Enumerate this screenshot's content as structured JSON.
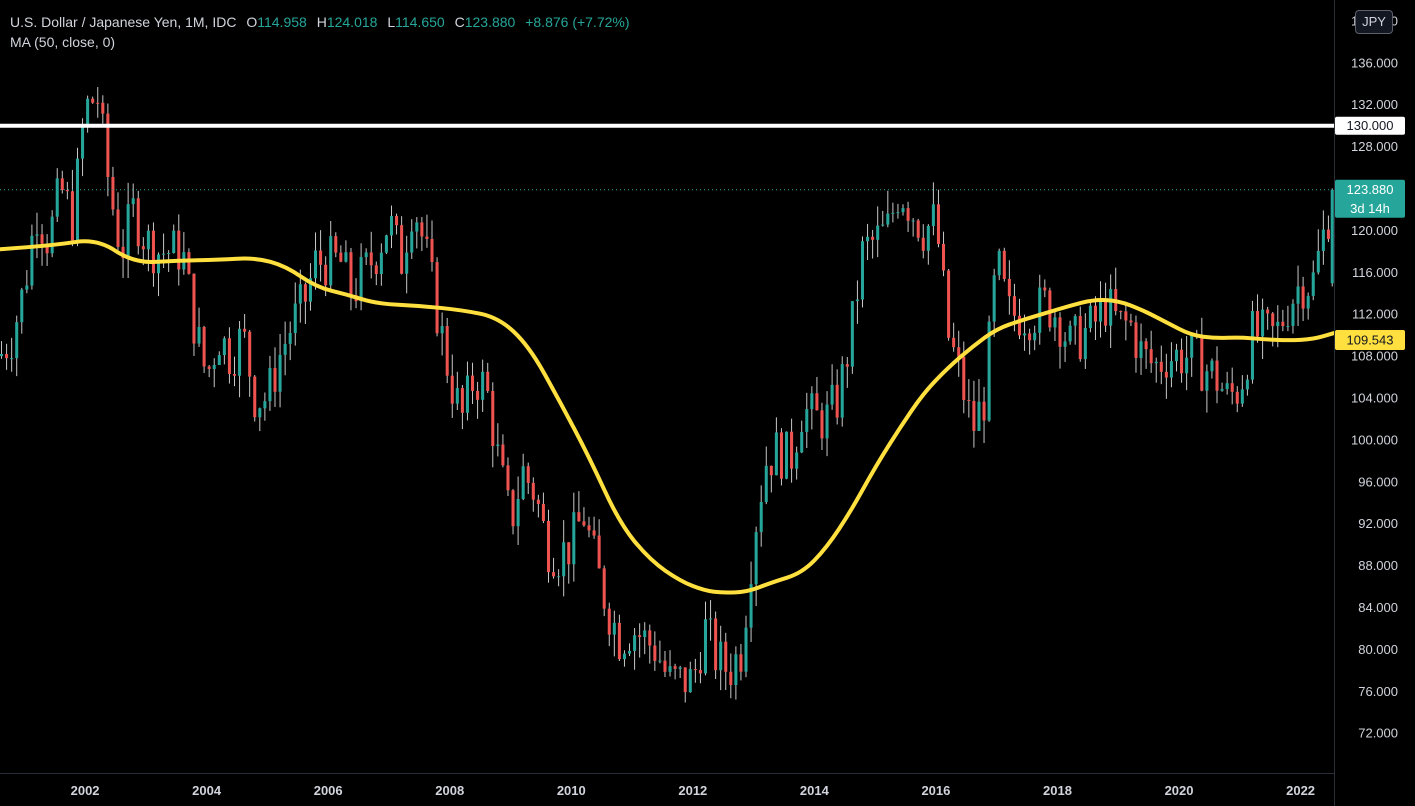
{
  "legend": {
    "symbol": "U.S. Dollar / Japanese Yen, 1M, IDC",
    "open_label": "O",
    "open": "114.958",
    "high_label": "H",
    "high": "124.018",
    "low_label": "L",
    "low": "114.650",
    "close_label": "C",
    "close": "123.880",
    "change": "+8.876 (+7.72%)",
    "ma": "MA (50, close, 0)"
  },
  "currency": "JPY",
  "colors": {
    "background": "#000000",
    "up": "#26a69a",
    "down": "#ef5350",
    "ma": "#ffe03f",
    "hline": "#ffffff",
    "axis_text": "#d1d4dc"
  },
  "labels": {
    "hline": "130.000",
    "last_price": "123.880",
    "countdown": "3d 14h",
    "ma_value": "109.543"
  },
  "chart_data": {
    "type": "candlestick",
    "title": "U.S. Dollar / Japanese Yen, 1M, IDC",
    "x_range": [
      2000.6,
      2022.55
    ],
    "y_range": [
      68.2,
      142.0
    ],
    "y_ticks": [
      "72.000",
      "76.000",
      "80.000",
      "84.000",
      "88.000",
      "92.000",
      "96.000",
      "100.000",
      "104.000",
      "108.000",
      "112.000",
      "116.000",
      "120.000",
      "124.000",
      "128.000",
      "132.000",
      "136.000",
      "140.000"
    ],
    "y_tick_values": [
      72,
      76,
      80,
      84,
      88,
      92,
      96,
      100,
      104,
      108,
      112,
      116,
      120,
      124,
      128,
      132,
      136,
      140
    ],
    "x_ticks": [
      "2002",
      "2004",
      "2006",
      "2008",
      "2010",
      "2012",
      "2014",
      "2016",
      "2018",
      "2020",
      "2022"
    ],
    "x_tick_values": [
      2002,
      2004,
      2006,
      2008,
      2010,
      2012,
      2014,
      2016,
      2018,
      2020,
      2022
    ],
    "horizontal_line": 130.0,
    "last_price": 123.88,
    "closes": [
      [
        2000.6,
        108
      ],
      [
        2000.8,
        110
      ],
      [
        2001.0,
        114.5
      ],
      [
        2001.2,
        122
      ],
      [
        2001.4,
        119
      ],
      [
        2001.6,
        124
      ],
      [
        2001.8,
        121
      ],
      [
        2002.0,
        131.5
      ],
      [
        2002.2,
        133
      ],
      [
        2002.4,
        124
      ],
      [
        2002.6,
        118
      ],
      [
        2002.8,
        122
      ],
      [
        2003.0,
        119
      ],
      [
        2003.2,
        118
      ],
      [
        2003.4,
        118
      ],
      [
        2003.6,
        118
      ],
      [
        2003.8,
        111
      ],
      [
        2004.0,
        106
      ],
      [
        2004.2,
        110
      ],
      [
        2004.4,
        108
      ],
      [
        2004.6,
        110
      ],
      [
        2004.8,
        104
      ],
      [
        2005.0,
        104
      ],
      [
        2005.2,
        108
      ],
      [
        2005.4,
        111
      ],
      [
        2005.6,
        113
      ],
      [
        2005.8,
        117
      ],
      [
        2006.0,
        117
      ],
      [
        2006.2,
        117
      ],
      [
        2006.4,
        114
      ],
      [
        2006.6,
        116
      ],
      [
        2006.8,
        118
      ],
      [
        2007.0,
        121
      ],
      [
        2007.2,
        117
      ],
      [
        2007.4,
        123
      ],
      [
        2007.6,
        118
      ],
      [
        2007.8,
        112
      ],
      [
        2008.0,
        106
      ],
      [
        2008.2,
        102
      ],
      [
        2008.4,
        106
      ],
      [
        2008.6,
        105
      ],
      [
        2008.8,
        98
      ],
      [
        2009.0,
        92
      ],
      [
        2009.2,
        97
      ],
      [
        2009.4,
        95
      ],
      [
        2009.6,
        90
      ],
      [
        2009.8,
        89
      ],
      [
        2010.0,
        90
      ],
      [
        2010.2,
        93
      ],
      [
        2010.4,
        88
      ],
      [
        2010.6,
        84
      ],
      [
        2010.8,
        81
      ],
      [
        2011.0,
        82
      ],
      [
        2011.2,
        81
      ],
      [
        2011.4,
        80
      ],
      [
        2011.6,
        77
      ],
      [
        2011.8,
        77
      ],
      [
        2012.0,
        77
      ],
      [
        2012.2,
        82
      ],
      [
        2012.4,
        79
      ],
      [
        2012.6,
        78
      ],
      [
        2012.8,
        80
      ],
      [
        2013.0,
        91
      ],
      [
        2013.2,
        98
      ],
      [
        2013.4,
        99
      ],
      [
        2013.6,
        98
      ],
      [
        2013.8,
        103
      ],
      [
        2014.0,
        102
      ],
      [
        2014.2,
        102
      ],
      [
        2014.4,
        104
      ],
      [
        2014.6,
        110
      ],
      [
        2014.8,
        118
      ],
      [
        2015.0,
        119
      ],
      [
        2015.2,
        120
      ],
      [
        2015.4,
        124
      ],
      [
        2015.6,
        122
      ],
      [
        2015.8,
        120
      ],
      [
        2016.0,
        121
      ],
      [
        2016.2,
        110
      ],
      [
        2016.4,
        106
      ],
      [
        2016.6,
        101
      ],
      [
        2016.8,
        104
      ],
      [
        2017.0,
        117
      ],
      [
        2017.2,
        112
      ],
      [
        2017.4,
        112
      ],
      [
        2017.6,
        112
      ],
      [
        2017.8,
        113
      ],
      [
        2018.0,
        112
      ],
      [
        2018.2,
        109
      ],
      [
        2018.4,
        110
      ],
      [
        2018.6,
        111
      ],
      [
        2018.8,
        113
      ],
      [
        2019.0,
        111
      ],
      [
        2019.2,
        111
      ],
      [
        2019.4,
        108
      ],
      [
        2019.6,
        107
      ],
      [
        2019.8,
        108
      ],
      [
        2020.0,
        108
      ],
      [
        2020.2,
        108
      ],
      [
        2020.4,
        107
      ],
      [
        2020.6,
        106
      ],
      [
        2020.8,
        104
      ],
      [
        2021.0,
        105
      ],
      [
        2021.2,
        110
      ],
      [
        2021.4,
        110
      ],
      [
        2021.6,
        110
      ],
      [
        2021.8,
        113
      ],
      [
        2022.0,
        115
      ],
      [
        2022.2,
        115.0
      ],
      [
        2022.55,
        123.88
      ]
    ],
    "ma_series": {
      "name": "MA (50, close, 0)",
      "points": [
        [
          2000.6,
          118.2
        ],
        [
          2001.5,
          118.6
        ],
        [
          2002.2,
          119.2
        ],
        [
          2002.8,
          116.9
        ],
        [
          2003.5,
          117.1
        ],
        [
          2004.2,
          117.2
        ],
        [
          2004.8,
          117.4
        ],
        [
          2005.3,
          116.6
        ],
        [
          2005.8,
          114.6
        ],
        [
          2006.3,
          113.9
        ],
        [
          2006.8,
          113.0
        ],
        [
          2007.5,
          112.8
        ],
        [
          2008.2,
          112.4
        ],
        [
          2008.8,
          111.7
        ],
        [
          2009.3,
          109.0
        ],
        [
          2009.8,
          103.8
        ],
        [
          2010.3,
          98.3
        ],
        [
          2010.8,
          92.0
        ],
        [
          2011.3,
          88.5
        ],
        [
          2011.8,
          86.5
        ],
        [
          2012.2,
          85.6
        ],
        [
          2012.5,
          85.4
        ],
        [
          2012.9,
          85.5
        ],
        [
          2013.3,
          86.4
        ],
        [
          2013.8,
          87.3
        ],
        [
          2014.2,
          89.7
        ],
        [
          2014.6,
          93.2
        ],
        [
          2015.0,
          97.4
        ],
        [
          2015.4,
          101.1
        ],
        [
          2015.8,
          104.5
        ],
        [
          2016.2,
          106.9
        ],
        [
          2016.6,
          108.9
        ],
        [
          2017.0,
          110.6
        ],
        [
          2017.4,
          111.4
        ],
        [
          2017.8,
          112.1
        ],
        [
          2018.2,
          112.8
        ],
        [
          2018.6,
          113.4
        ],
        [
          2019.0,
          113.3
        ],
        [
          2019.4,
          112.4
        ],
        [
          2019.8,
          111.2
        ],
        [
          2020.2,
          110.0
        ],
        [
          2020.6,
          109.7
        ],
        [
          2021.0,
          109.8
        ],
        [
          2021.4,
          109.6
        ],
        [
          2021.8,
          109.5
        ],
        [
          2022.2,
          109.6
        ],
        [
          2022.55,
          110.2
        ]
      ]
    }
  }
}
